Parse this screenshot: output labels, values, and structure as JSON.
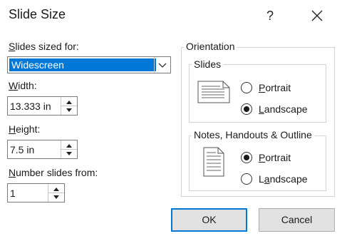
{
  "dialog": {
    "title": "Slide Size",
    "help_label": "?",
    "close_icon": "close-icon"
  },
  "slides_sized_for": {
    "label_prefix": "S",
    "label_rest": "lides sized for:",
    "selected": "Widescreen"
  },
  "width": {
    "label_prefix": "W",
    "label_rest": "idth:",
    "value": "13.333 in"
  },
  "height": {
    "label_prefix": "H",
    "label_rest": "eight:",
    "value": "7.5 in"
  },
  "number_slides_from": {
    "label_prefix": "N",
    "label_rest": "umber slides from:",
    "value": "1"
  },
  "orientation": {
    "title": "Orientation",
    "slides": {
      "title": "Slides",
      "portrait": {
        "prefix": "P",
        "rest": "ortrait",
        "checked": false
      },
      "landscape": {
        "prefix": "L",
        "rest": "andscape",
        "checked": true
      }
    },
    "notes": {
      "title": "Notes, Handouts & Outline",
      "portrait": {
        "prefix": "P",
        "rest": "ortrait",
        "checked": true
      },
      "landscape": {
        "prefix": "a",
        "before": "L",
        "rest": "ndscape",
        "checked": false
      }
    }
  },
  "buttons": {
    "ok": "OK",
    "cancel": "Cancel"
  },
  "colors": {
    "accent": "#0078d7"
  }
}
